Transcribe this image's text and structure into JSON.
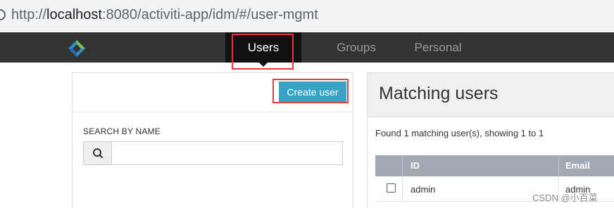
{
  "browser": {
    "url_prefix": "http://",
    "url_host": "localhost",
    "url_rest": ":8080/activiti-app/idm/#/user-mgmt"
  },
  "nav": {
    "items": [
      {
        "label": "Users",
        "active": true
      },
      {
        "label": "Groups",
        "active": false
      },
      {
        "label": "Personal",
        "active": false
      }
    ]
  },
  "left_panel": {
    "create_label": "Create user",
    "search_label": "SEARCH BY NAME",
    "search_value": ""
  },
  "right_panel": {
    "title": "Matching users",
    "summary": "Found 1 matching user(s), showing 1 to 1",
    "columns": [
      "ID",
      "Email"
    ],
    "rows": [
      {
        "id": "admin",
        "email": "admin",
        "checked": false
      }
    ]
  },
  "watermark": "CSDN @小百菜",
  "colors": {
    "nav_bg": "#333333",
    "nav_active_bg": "#111111",
    "primary_button": "#36a3c7",
    "table_header": "#a3a9b4",
    "highlight": "#e23b3b"
  }
}
